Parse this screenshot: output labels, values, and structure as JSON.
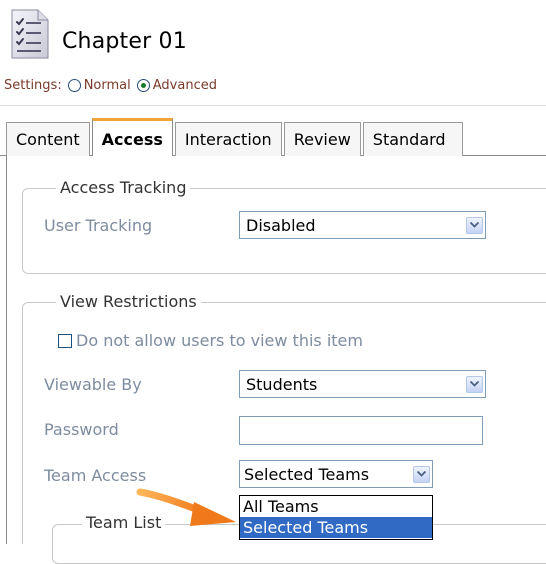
{
  "header": {
    "title": "Chapter 01",
    "icon": "checklist-document-icon"
  },
  "settings": {
    "label": "Settings:",
    "options": [
      {
        "label": "Normal",
        "checked": false
      },
      {
        "label": "Advanced",
        "checked": true
      }
    ]
  },
  "tabs": [
    {
      "label": "Content",
      "active": false
    },
    {
      "label": "Access",
      "active": true
    },
    {
      "label": "Interaction",
      "active": false
    },
    {
      "label": "Review",
      "active": false
    },
    {
      "label": "Standard",
      "active": false
    }
  ],
  "access_tracking": {
    "legend": "Access Tracking",
    "user_tracking_label": "User Tracking",
    "user_tracking_value": "Disabled"
  },
  "view_restrictions": {
    "legend": "View Restrictions",
    "checkbox_label": "Do not allow users to view this item",
    "checkbox_checked": false,
    "viewable_by_label": "Viewable By",
    "viewable_by_value": "Students",
    "password_label": "Password",
    "password_value": "",
    "team_access_label": "Team Access",
    "team_access_value": "Selected Teams",
    "team_access_options": [
      "All Teams",
      "Selected Teams"
    ],
    "team_access_highlighted": "Selected Teams"
  },
  "team_list": {
    "legend": "Team List"
  },
  "colors": {
    "accent_tab": "#f0a43a",
    "annotation_arrow": "#f0922b",
    "selection": "#316ac5",
    "label_text": "#7d8ca0",
    "settings_text": "#7a3a2a"
  }
}
